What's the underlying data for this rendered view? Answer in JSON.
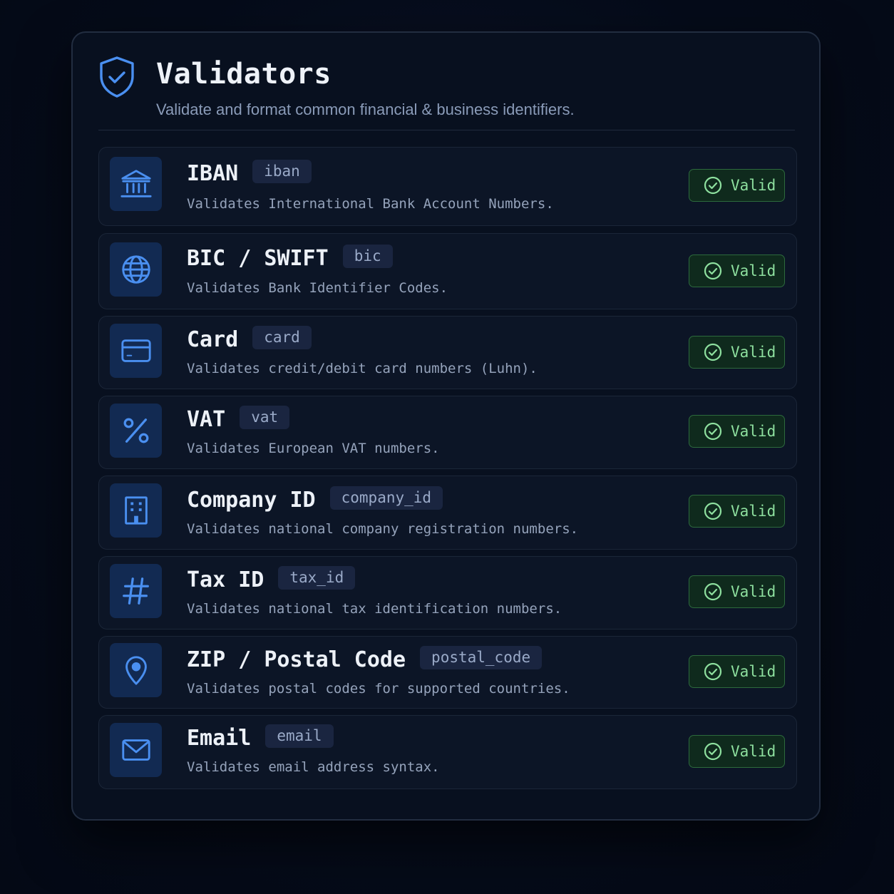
{
  "header": {
    "icon": "shield-check-icon",
    "title": "Validators",
    "subtitle": "Validate and format common financial & business identifiers."
  },
  "colors": {
    "accent": "#4a8ff0",
    "valid_text": "#8ee09f",
    "valid_border": "#2d6a3d"
  },
  "validators": [
    {
      "icon": "bank-icon",
      "name": "IBAN",
      "key": "iban",
      "description": "Validates International Bank Account Numbers.",
      "status": "Valid"
    },
    {
      "icon": "globe-icon",
      "name": "BIC / SWIFT",
      "key": "bic",
      "description": "Validates Bank Identifier Codes.",
      "status": "Valid"
    },
    {
      "icon": "credit-card-icon",
      "name": "Card",
      "key": "card",
      "description": "Validates credit/debit card numbers (Luhn).",
      "status": "Valid"
    },
    {
      "icon": "percent-icon",
      "name": "VAT",
      "key": "vat",
      "description": "Validates European VAT numbers.",
      "status": "Valid"
    },
    {
      "icon": "building-icon",
      "name": "Company ID",
      "key": "company_id",
      "description": "Validates national company registration numbers.",
      "status": "Valid"
    },
    {
      "icon": "hash-icon",
      "name": "Tax ID",
      "key": "tax_id",
      "description": "Validates national tax identification numbers.",
      "status": "Valid"
    },
    {
      "icon": "map-pin-icon",
      "name": "ZIP / Postal Code",
      "key": "postal_code",
      "description": "Validates postal codes for supported countries.",
      "status": "Valid"
    },
    {
      "icon": "mail-icon",
      "name": "Email",
      "key": "email",
      "description": "Validates email address syntax.",
      "status": "Valid"
    }
  ]
}
